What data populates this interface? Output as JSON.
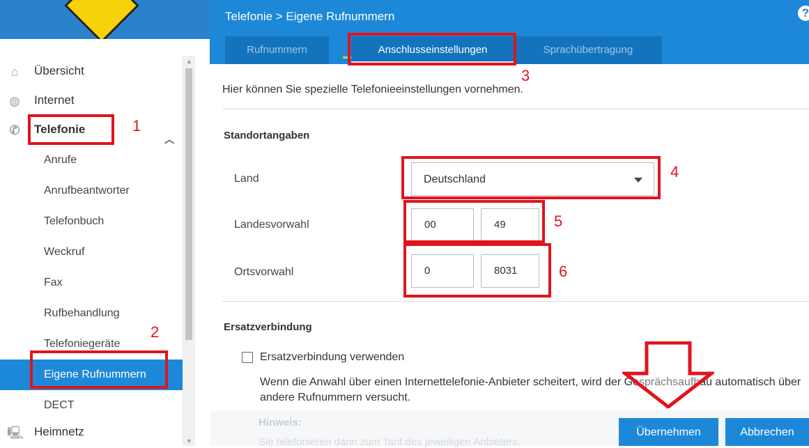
{
  "header": {
    "breadcrumb": "Telefonie > Eigene Rufnummern",
    "help": "?"
  },
  "tabs": [
    {
      "label": "Rufnummern",
      "active": false
    },
    {
      "label": "Anschlusseinstellungen",
      "active": true
    },
    {
      "label": "Sprachübertragung",
      "active": false
    }
  ],
  "sidebar": {
    "items": [
      {
        "label": "Übersicht",
        "icon": "home-icon",
        "glyph": "⌂"
      },
      {
        "label": "Internet",
        "icon": "globe-icon",
        "glyph": "◍"
      },
      {
        "label": "Telefonie",
        "icon": "phone-icon",
        "glyph": "✆"
      }
    ],
    "chevron": "︿",
    "subitems": [
      {
        "label": "Anrufe"
      },
      {
        "label": "Anrufbeantworter"
      },
      {
        "label": "Telefonbuch"
      },
      {
        "label": "Weckruf"
      },
      {
        "label": "Fax"
      },
      {
        "label": "Rufbehandlung"
      },
      {
        "label": "Telefoniegeräte"
      },
      {
        "label": "Eigene Rufnummern",
        "active": true
      },
      {
        "label": "DECT"
      }
    ],
    "bottom_item": {
      "label": "Heimnetz",
      "icon": "network-icon",
      "glyph": "🖳"
    }
  },
  "main": {
    "intro": "Hier können Sie spezielle Telefonieeinstellungen vornehmen.",
    "standort": {
      "title": "Standortangaben",
      "land_label": "Land",
      "land_value": "Deutschland",
      "landesvorwahl_label": "Landesvorwahl",
      "landesvorwahl_prefix": "00",
      "landesvorwahl_code": "49",
      "ortsvorwahl_label": "Ortsvorwahl",
      "ortsvorwahl_prefix": "0",
      "ortsvorwahl_code": "8031"
    },
    "ersatz": {
      "title": "Ersatzverbindung",
      "checkbox_label": "Ersatzverbindung verwenden",
      "checked": false,
      "description": "Wenn die Anwahl über einen Internettelefonie-Anbieter scheitert, wird der Gesprächsaufbau automatisch über andere Rufnummern versucht.",
      "hint_title": "Hinweis:",
      "hint_text": "Sie telefonieren dann zum Tarif des jeweiligen Anbieters."
    },
    "buttons": {
      "apply": "Übernehmen",
      "cancel": "Abbrechen"
    }
  },
  "annotations": {
    "n1": "1",
    "n2": "2",
    "n3": "3",
    "n4": "4",
    "n5": "5",
    "n6": "6",
    "color": "#e0141e"
  },
  "colors": {
    "accent": "#1e88d8",
    "tab_bg": "#1374bd",
    "annotation": "#e0141e",
    "logo": "#f5d20a"
  }
}
